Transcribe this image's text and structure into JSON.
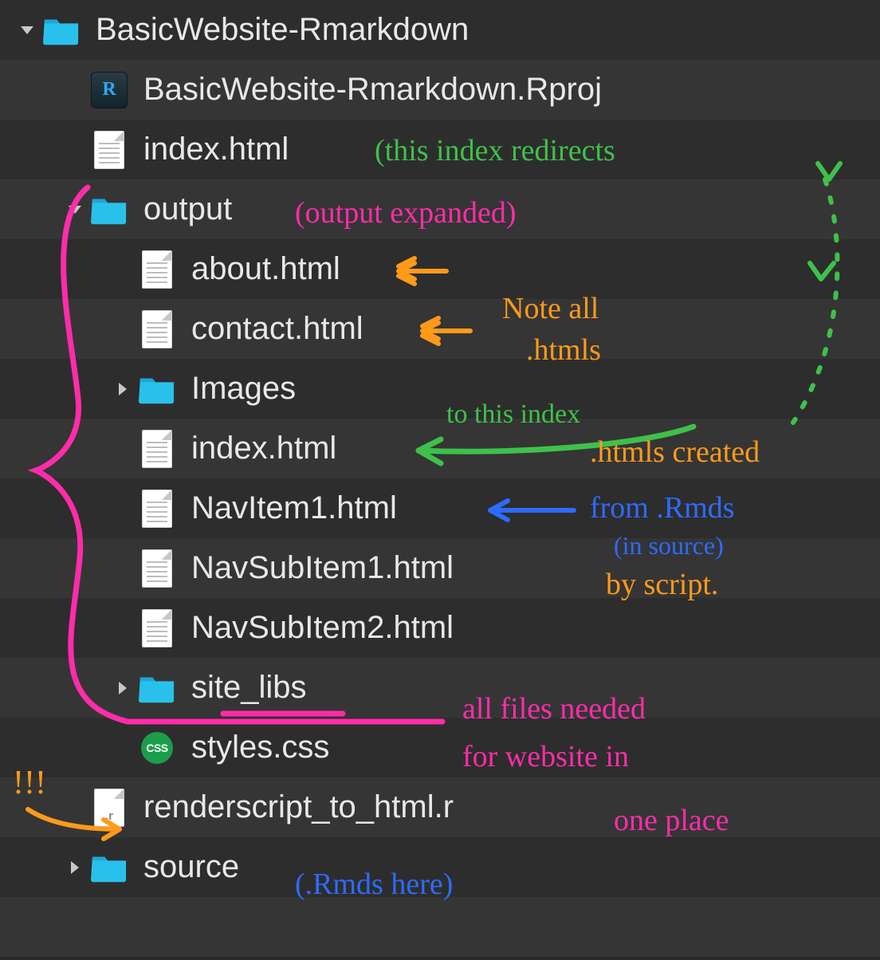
{
  "tree": {
    "root": {
      "label": "BasicWebsite-Rmarkdown"
    },
    "rproj": {
      "label": "BasicWebsite-Rmarkdown.Rproj"
    },
    "index_root": {
      "label": "index.html"
    },
    "output": {
      "label": "output"
    },
    "about": {
      "label": "about.html"
    },
    "contact": {
      "label": "contact.html"
    },
    "images": {
      "label": "Images"
    },
    "index_out": {
      "label": "index.html"
    },
    "nav1": {
      "label": "NavItem1.html"
    },
    "navsub1": {
      "label": "NavSubItem1.html"
    },
    "navsub2": {
      "label": "NavSubItem2.html"
    },
    "site_libs": {
      "label": "site_libs"
    },
    "styles": {
      "label": "styles.css"
    },
    "render": {
      "label": "renderscript_to_html.r"
    },
    "source": {
      "label": "source"
    }
  },
  "annotations": {
    "a1": "(this index redirects",
    "a2": "(output expanded)",
    "a3a": "Note all",
    "a3b": ".htmls",
    "a4": "to this index",
    "a5a": ".htmls created",
    "a5b": "from .Rmds",
    "a5c": "(in source)",
    "a5d": "by script.",
    "a6a": "all files needed",
    "a6b": "for website in",
    "a6c": "one place",
    "a7": "!!!",
    "a8": "(.Rmds here)"
  },
  "css_badge": "CSS",
  "rproj_letter": "R"
}
